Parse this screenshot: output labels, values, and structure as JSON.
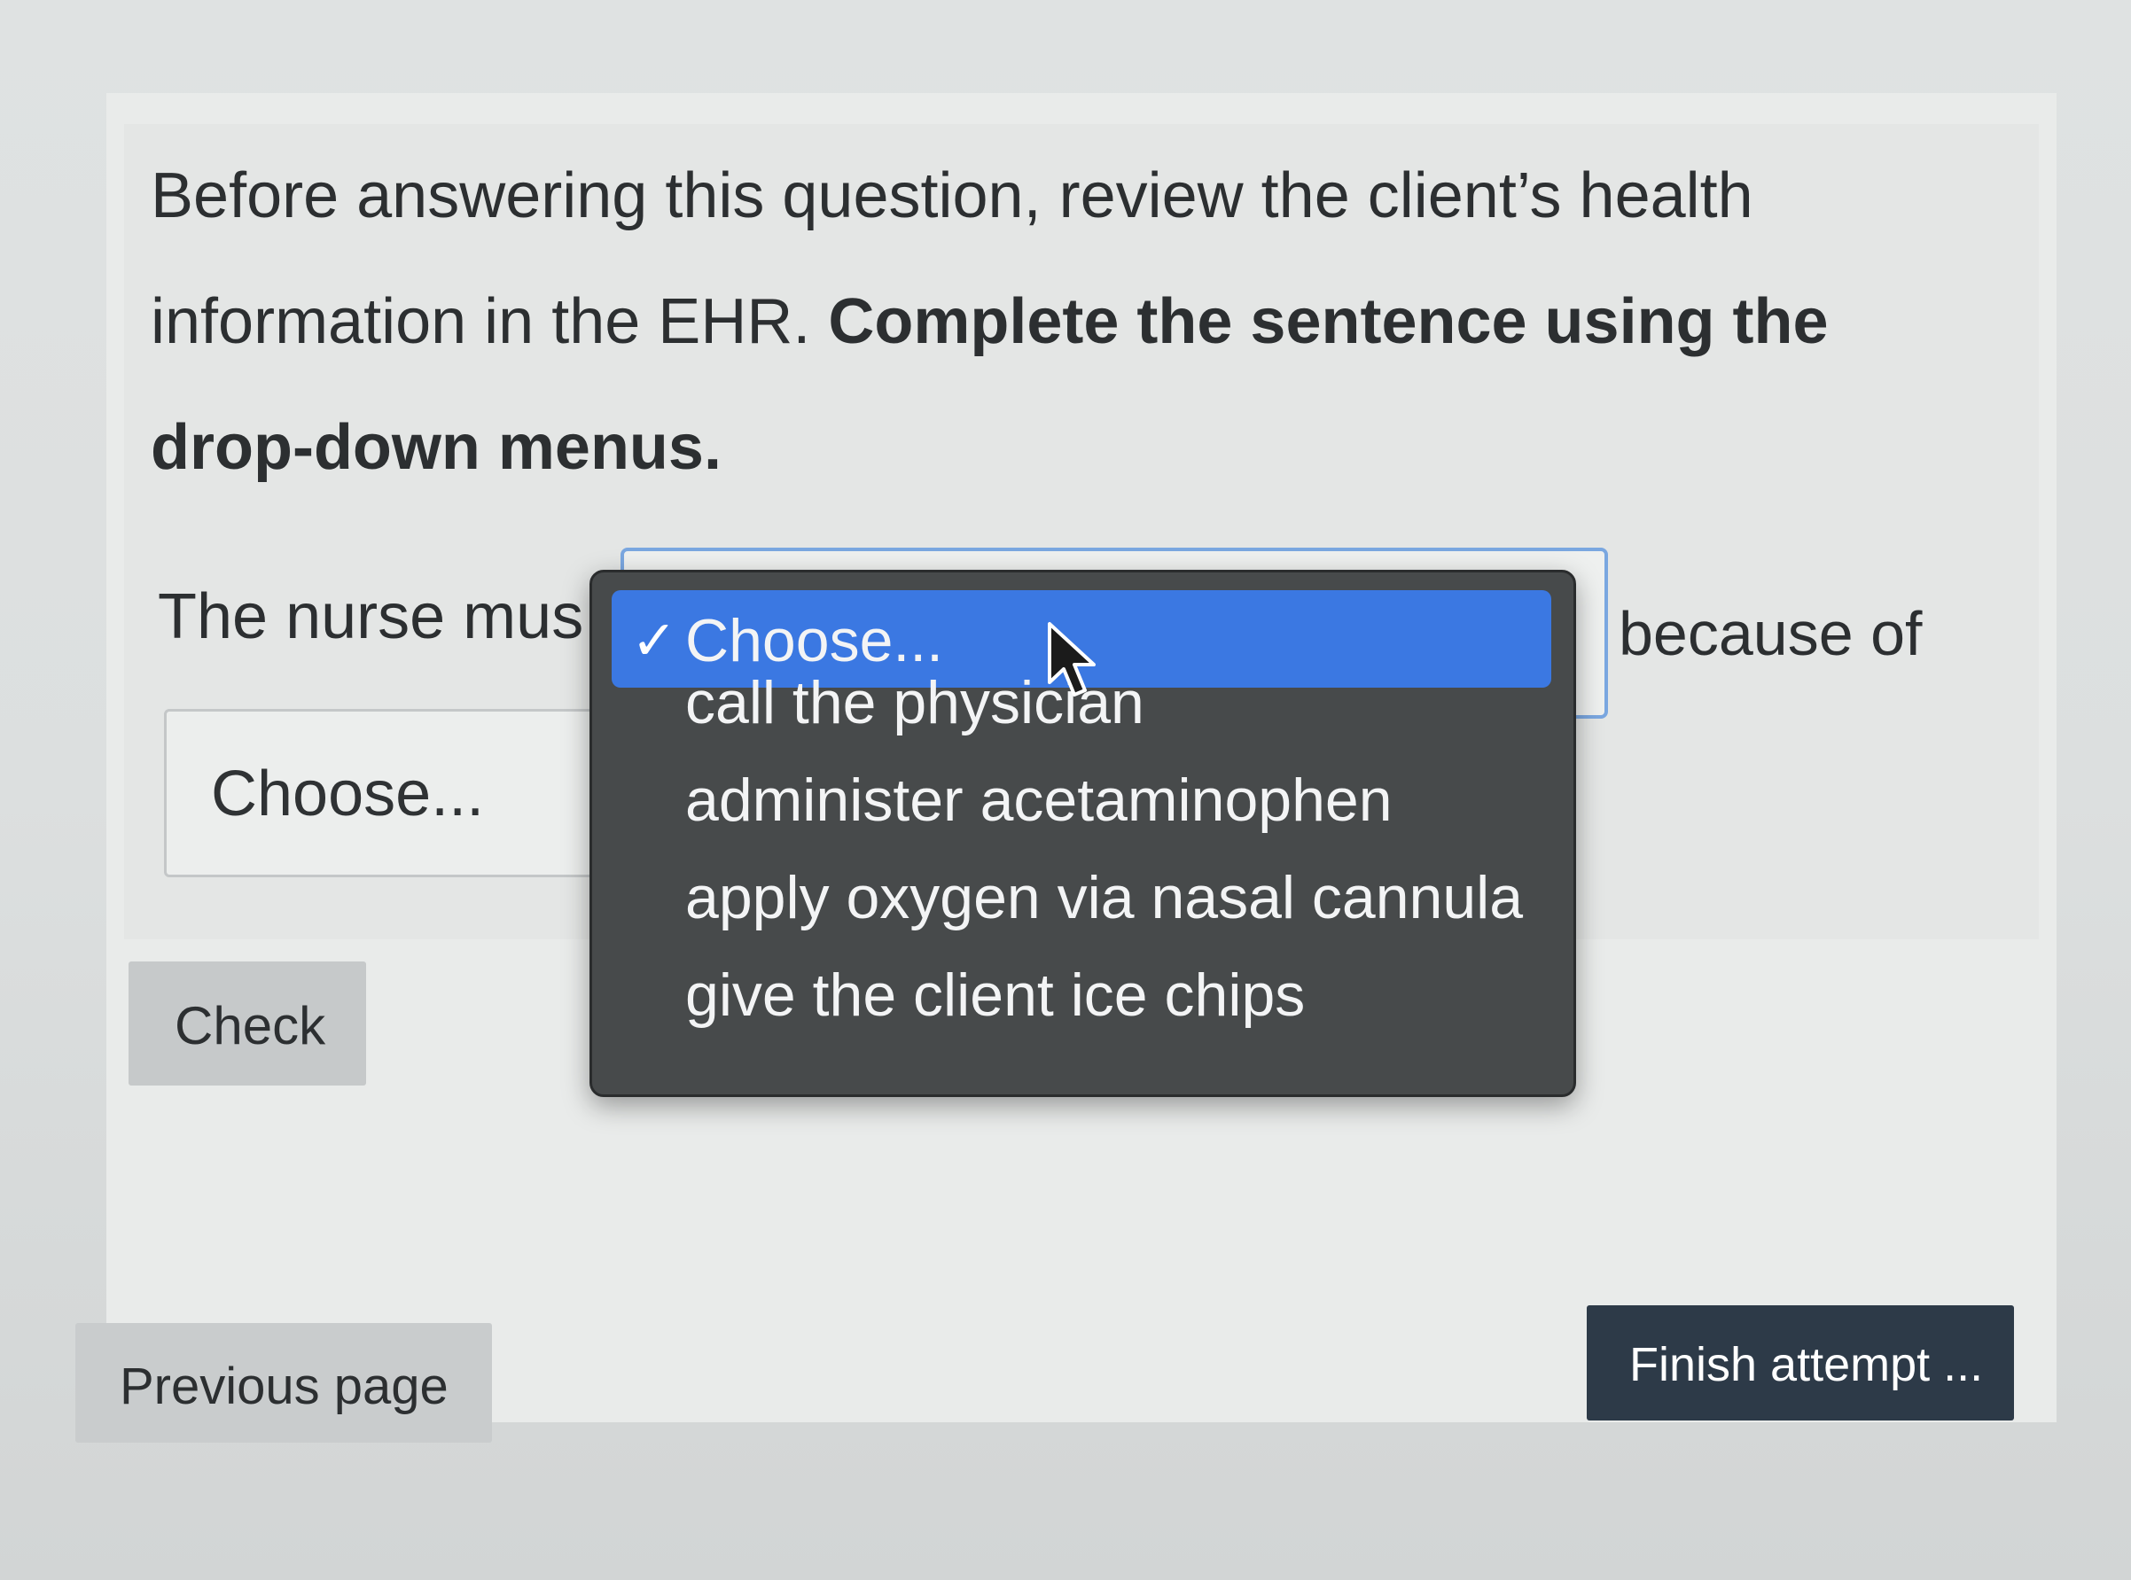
{
  "question": {
    "intro_text": "Before answering this question, review the client’s health information in the EHR.",
    "instruction_text": "Complete the sentence using the drop-down menus."
  },
  "sentence": {
    "lead_text": "The nurse mus",
    "tail_text": "because of"
  },
  "select_one": {
    "options": [
      {
        "label": "Choose...",
        "selected": true
      },
      {
        "label": "call the physician",
        "selected": false
      },
      {
        "label": "administer acetaminophen",
        "selected": false
      },
      {
        "label": "apply oxygen via nasal cannula",
        "selected": false
      },
      {
        "label": "give the client ice chips",
        "selected": false
      }
    ],
    "check_mark": "✓"
  },
  "select_two": {
    "value": "Choose..."
  },
  "buttons": {
    "check_label": "Check",
    "previous_label": "Previous page",
    "finish_label": "Finish attempt ..."
  },
  "icons": {
    "cursor": "mouse-pointer-icon"
  },
  "colors": {
    "menu_background": "#474a4b",
    "selected_option": "#3b78e2",
    "finish_button": "#2d3a48",
    "focus_border": "#7aa7e0"
  }
}
